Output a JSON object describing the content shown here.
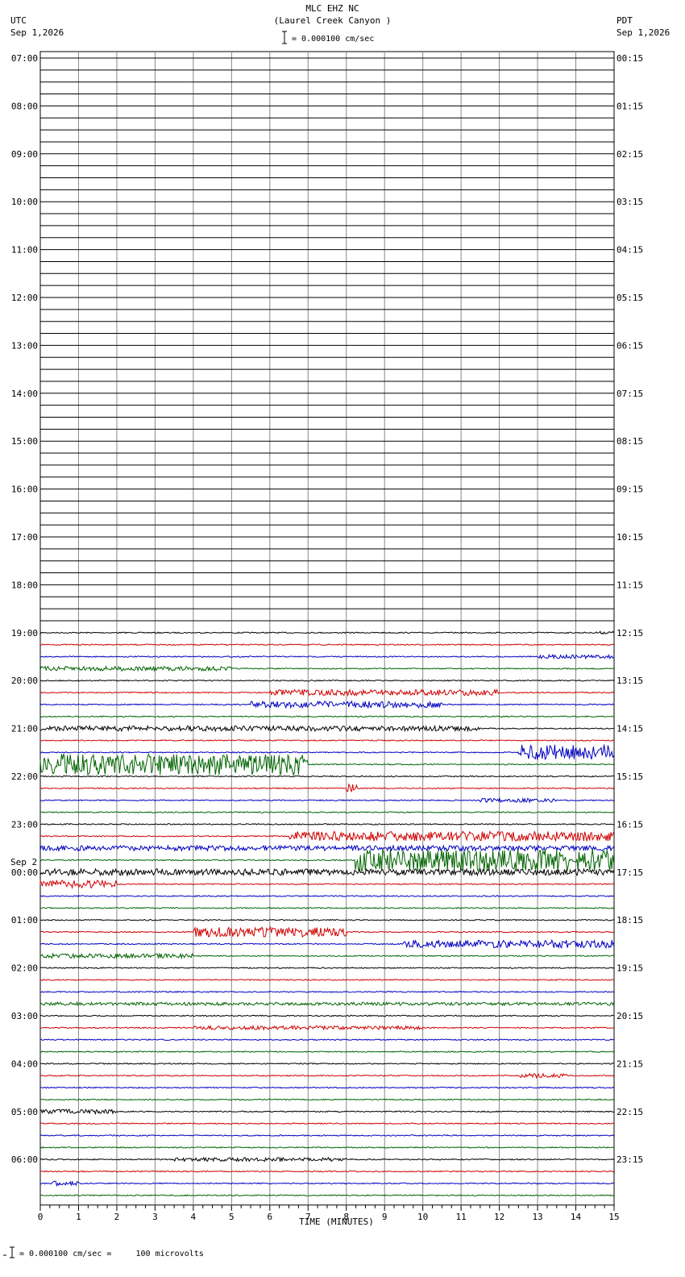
{
  "header": {
    "station": "MLC EHZ NC",
    "location": "(Laurel Creek Canyon )",
    "scale_text": "= 0.000100 cm/sec",
    "left_zone": "UTC",
    "left_date": "Sep 1,2026",
    "right_zone": "PDT",
    "right_date": "Sep 1,2026"
  },
  "footer": {
    "scale_text": "= 0.000100 cm/sec =     100 microvolts"
  },
  "chart_data": {
    "type": "line",
    "title": "MLC EHZ NC (Laurel Creek Canyon )",
    "xlabel": "TIME (MINUTES)",
    "ylabel": "",
    "xlim": [
      0,
      15
    ],
    "x_ticks": [
      "0",
      "1",
      "2",
      "3",
      "4",
      "5",
      "6",
      "7",
      "8",
      "9",
      "10",
      "11",
      "12",
      "13",
      "14",
      "15"
    ],
    "rows_per_hour": 4,
    "row_count": 48,
    "left_hour_labels": [
      "07:00",
      "08:00",
      "09:00",
      "10:00",
      "11:00",
      "12:00",
      "13:00",
      "14:00",
      "15:00",
      "16:00",
      "17:00",
      "18:00",
      "19:00",
      "20:00",
      "21:00",
      "22:00",
      "23:00",
      "00:00",
      "01:00",
      "02:00",
      "03:00",
      "04:00",
      "05:00",
      "06:00"
    ],
    "right_hour_labels": [
      "00:15",
      "01:15",
      "02:15",
      "03:15",
      "04:15",
      "05:15",
      "06:15",
      "07:15",
      "08:15",
      "09:15",
      "10:15",
      "11:15",
      "12:15",
      "13:15",
      "14:15",
      "15:15",
      "16:15",
      "17:15",
      "18:15",
      "19:15",
      "20:15",
      "21:15",
      "22:15",
      "23:15"
    ],
    "date_change_label": "Sep 2",
    "date_change_hour_index": 17,
    "trace_colors": [
      "#000000",
      "#d00000",
      "#0000c0",
      "#006400"
    ],
    "active_from_row": 48,
    "active_note": "rows start at 19:00 UTC; earlier rows flat",
    "events": [
      {
        "row": 48,
        "start_min": 14.5,
        "end_min": 15.0,
        "amplitude": 0.25
      },
      {
        "row": 50,
        "start_min": 13.0,
        "end_min": 15.0,
        "amplitude": 0.4
      },
      {
        "row": 51,
        "start_min": 0.0,
        "end_min": 5.0,
        "amplitude": 0.5
      },
      {
        "row": 53,
        "start_min": 6.0,
        "end_min": 12.0,
        "amplitude": 0.7
      },
      {
        "row": 54,
        "start_min": 5.5,
        "end_min": 10.5,
        "amplitude": 0.8
      },
      {
        "row": 56,
        "start_min": 0.0,
        "end_min": 11.5,
        "amplitude": 0.6
      },
      {
        "row": 58,
        "start_min": 12.5,
        "end_min": 15.0,
        "amplitude": 2.2
      },
      {
        "row": 59,
        "start_min": 0.0,
        "end_min": 7.0,
        "amplitude": 3.0
      },
      {
        "row": 61,
        "start_min": 8.0,
        "end_min": 8.3,
        "amplitude": 1.5
      },
      {
        "row": 62,
        "start_min": 11.5,
        "end_min": 13.5,
        "amplitude": 0.4
      },
      {
        "row": 65,
        "start_min": 6.5,
        "end_min": 15.0,
        "amplitude": 1.3
      },
      {
        "row": 66,
        "start_min": 0.0,
        "end_min": 15.0,
        "amplitude": 0.6
      },
      {
        "row": 67,
        "start_min": 8.2,
        "end_min": 15.0,
        "amplitude": 3.2
      },
      {
        "row": 68,
        "start_min": 0.0,
        "end_min": 15.0,
        "amplitude": 0.8
      },
      {
        "row": 69,
        "start_min": 0.0,
        "end_min": 2.0,
        "amplitude": 1.0
      },
      {
        "row": 73,
        "start_min": 4.0,
        "end_min": 8.0,
        "amplitude": 1.3
      },
      {
        "row": 74,
        "start_min": 9.5,
        "end_min": 15.0,
        "amplitude": 1.0
      },
      {
        "row": 75,
        "start_min": 0.0,
        "end_min": 4.0,
        "amplitude": 0.5
      },
      {
        "row": 79,
        "start_min": 0.0,
        "end_min": 15.0,
        "amplitude": 0.3
      },
      {
        "row": 81,
        "start_min": 4.0,
        "end_min": 10.0,
        "amplitude": 0.4
      },
      {
        "row": 85,
        "start_min": 12.5,
        "end_min": 13.8,
        "amplitude": 0.5
      },
      {
        "row": 88,
        "start_min": 0.0,
        "end_min": 2.0,
        "amplitude": 0.5
      },
      {
        "row": 92,
        "start_min": 3.5,
        "end_min": 8.0,
        "amplitude": 0.4
      },
      {
        "row": 94,
        "start_min": 0.3,
        "end_min": 1.0,
        "amplitude": 0.5
      }
    ]
  }
}
